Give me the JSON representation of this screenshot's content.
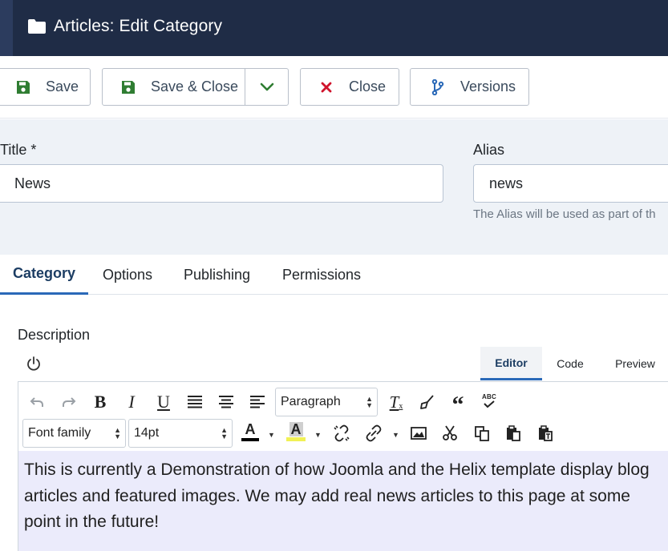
{
  "header": {
    "title": "Articles: Edit Category",
    "icon": "folder-icon"
  },
  "toolbar": {
    "save_label": "Save",
    "save_close_label": "Save & Close",
    "close_label": "Close",
    "versions_label": "Versions",
    "colors": {
      "save": "#2f7d32",
      "close": "#d0142c",
      "versions": "#2a69b8"
    }
  },
  "form": {
    "title_label": "Title *",
    "title_value": "News",
    "alias_label": "Alias",
    "alias_value": "news",
    "alias_help": "The Alias will be used as part of th"
  },
  "tabs": [
    {
      "label": "Category",
      "active": true
    },
    {
      "label": "Options",
      "active": false
    },
    {
      "label": "Publishing",
      "active": false
    },
    {
      "label": "Permissions",
      "active": false
    }
  ],
  "description": {
    "label": "Description",
    "editor_tabs": [
      {
        "label": "Editor",
        "active": true
      },
      {
        "label": "Code",
        "active": false
      },
      {
        "label": "Preview",
        "active": false
      }
    ],
    "format_select": "Paragraph",
    "font_family": "Font family",
    "font_size": "14pt",
    "text_color_letter": "A",
    "bg_color_letter": "A",
    "spellcheck_label": "ABC",
    "content": "This is currently a Demonstration of how Joomla and the Helix template display blog articles and featured images. We may add real news articles to this page at some point in the future!"
  }
}
